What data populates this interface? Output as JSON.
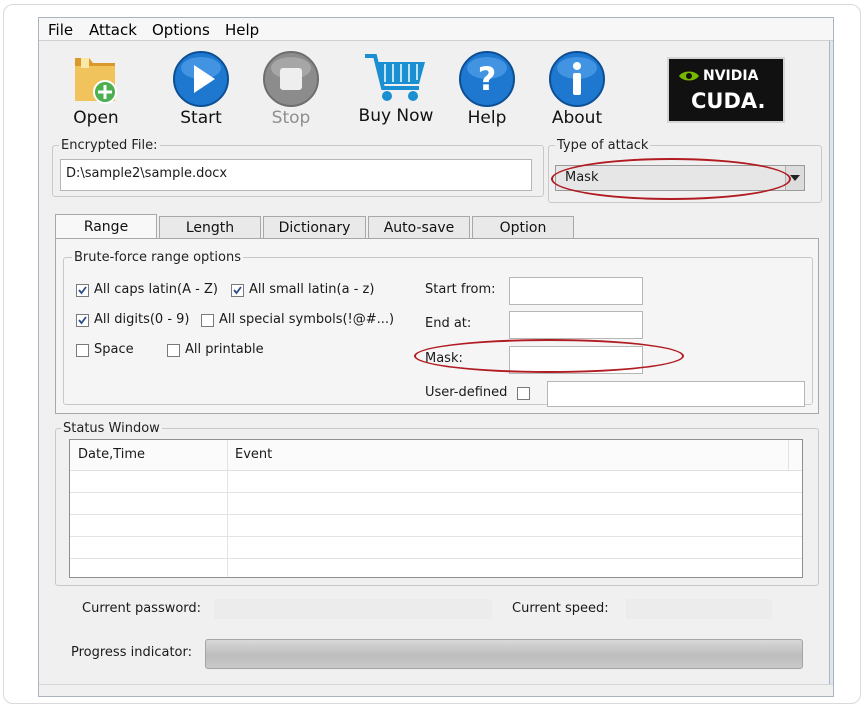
{
  "menu": {
    "items": [
      "File",
      "Attack",
      "Options",
      "Help"
    ]
  },
  "toolbar": {
    "open_label": "Open",
    "start_label": "Start",
    "stop_label": "Stop",
    "buy_label": "Buy Now",
    "help_label": "Help",
    "about_label": "About",
    "badge_brand": "NVIDIA",
    "badge_product": "CUDA."
  },
  "encrypted": {
    "label": "Encrypted File:",
    "value": "D:\\sample2\\sample.docx"
  },
  "attack": {
    "label": "Type of attack",
    "selected": "Mask"
  },
  "tabs": [
    {
      "label": "Range",
      "active": true
    },
    {
      "label": "Length",
      "active": false
    },
    {
      "label": "Dictionary",
      "active": false
    },
    {
      "label": "Auto-save",
      "active": false
    },
    {
      "label": "Option",
      "active": false
    }
  ],
  "range": {
    "group_label": "Brute-force range options",
    "options": [
      {
        "label": "All caps latin(A - Z)",
        "checked": true
      },
      {
        "label": "All small latin(a - z)",
        "checked": true
      },
      {
        "label": "All digits(0 - 9)",
        "checked": true
      },
      {
        "label": "All special symbols(!@#...)",
        "checked": false
      },
      {
        "label": "Space",
        "checked": false
      },
      {
        "label": "All printable",
        "checked": false
      }
    ],
    "start_from_label": "Start from:",
    "start_from_value": "",
    "end_at_label": "End at:",
    "end_at_value": "",
    "mask_label": "Mask:",
    "mask_value": "",
    "user_defined_label": "User-defined",
    "user_defined_checked": false,
    "user_defined_value": ""
  },
  "status": {
    "group_label": "Status Window",
    "columns": [
      "Date,Time",
      "Event"
    ],
    "rows": []
  },
  "footer": {
    "current_password_label": "Current password:",
    "current_password_value": "",
    "current_speed_label": "Current speed:",
    "current_speed_value": "",
    "progress_label": "Progress indicator:",
    "progress": 0
  },
  "colors": {
    "highlight_ring": "#b01c22",
    "start_icon": "#1f78d0",
    "stop_icon": "#8c8c8c",
    "cart_icon": "#1a8fd1",
    "folder_icon": "#e2a93a",
    "add_badge": "#4caf50",
    "nvidia_green": "#76b900"
  }
}
